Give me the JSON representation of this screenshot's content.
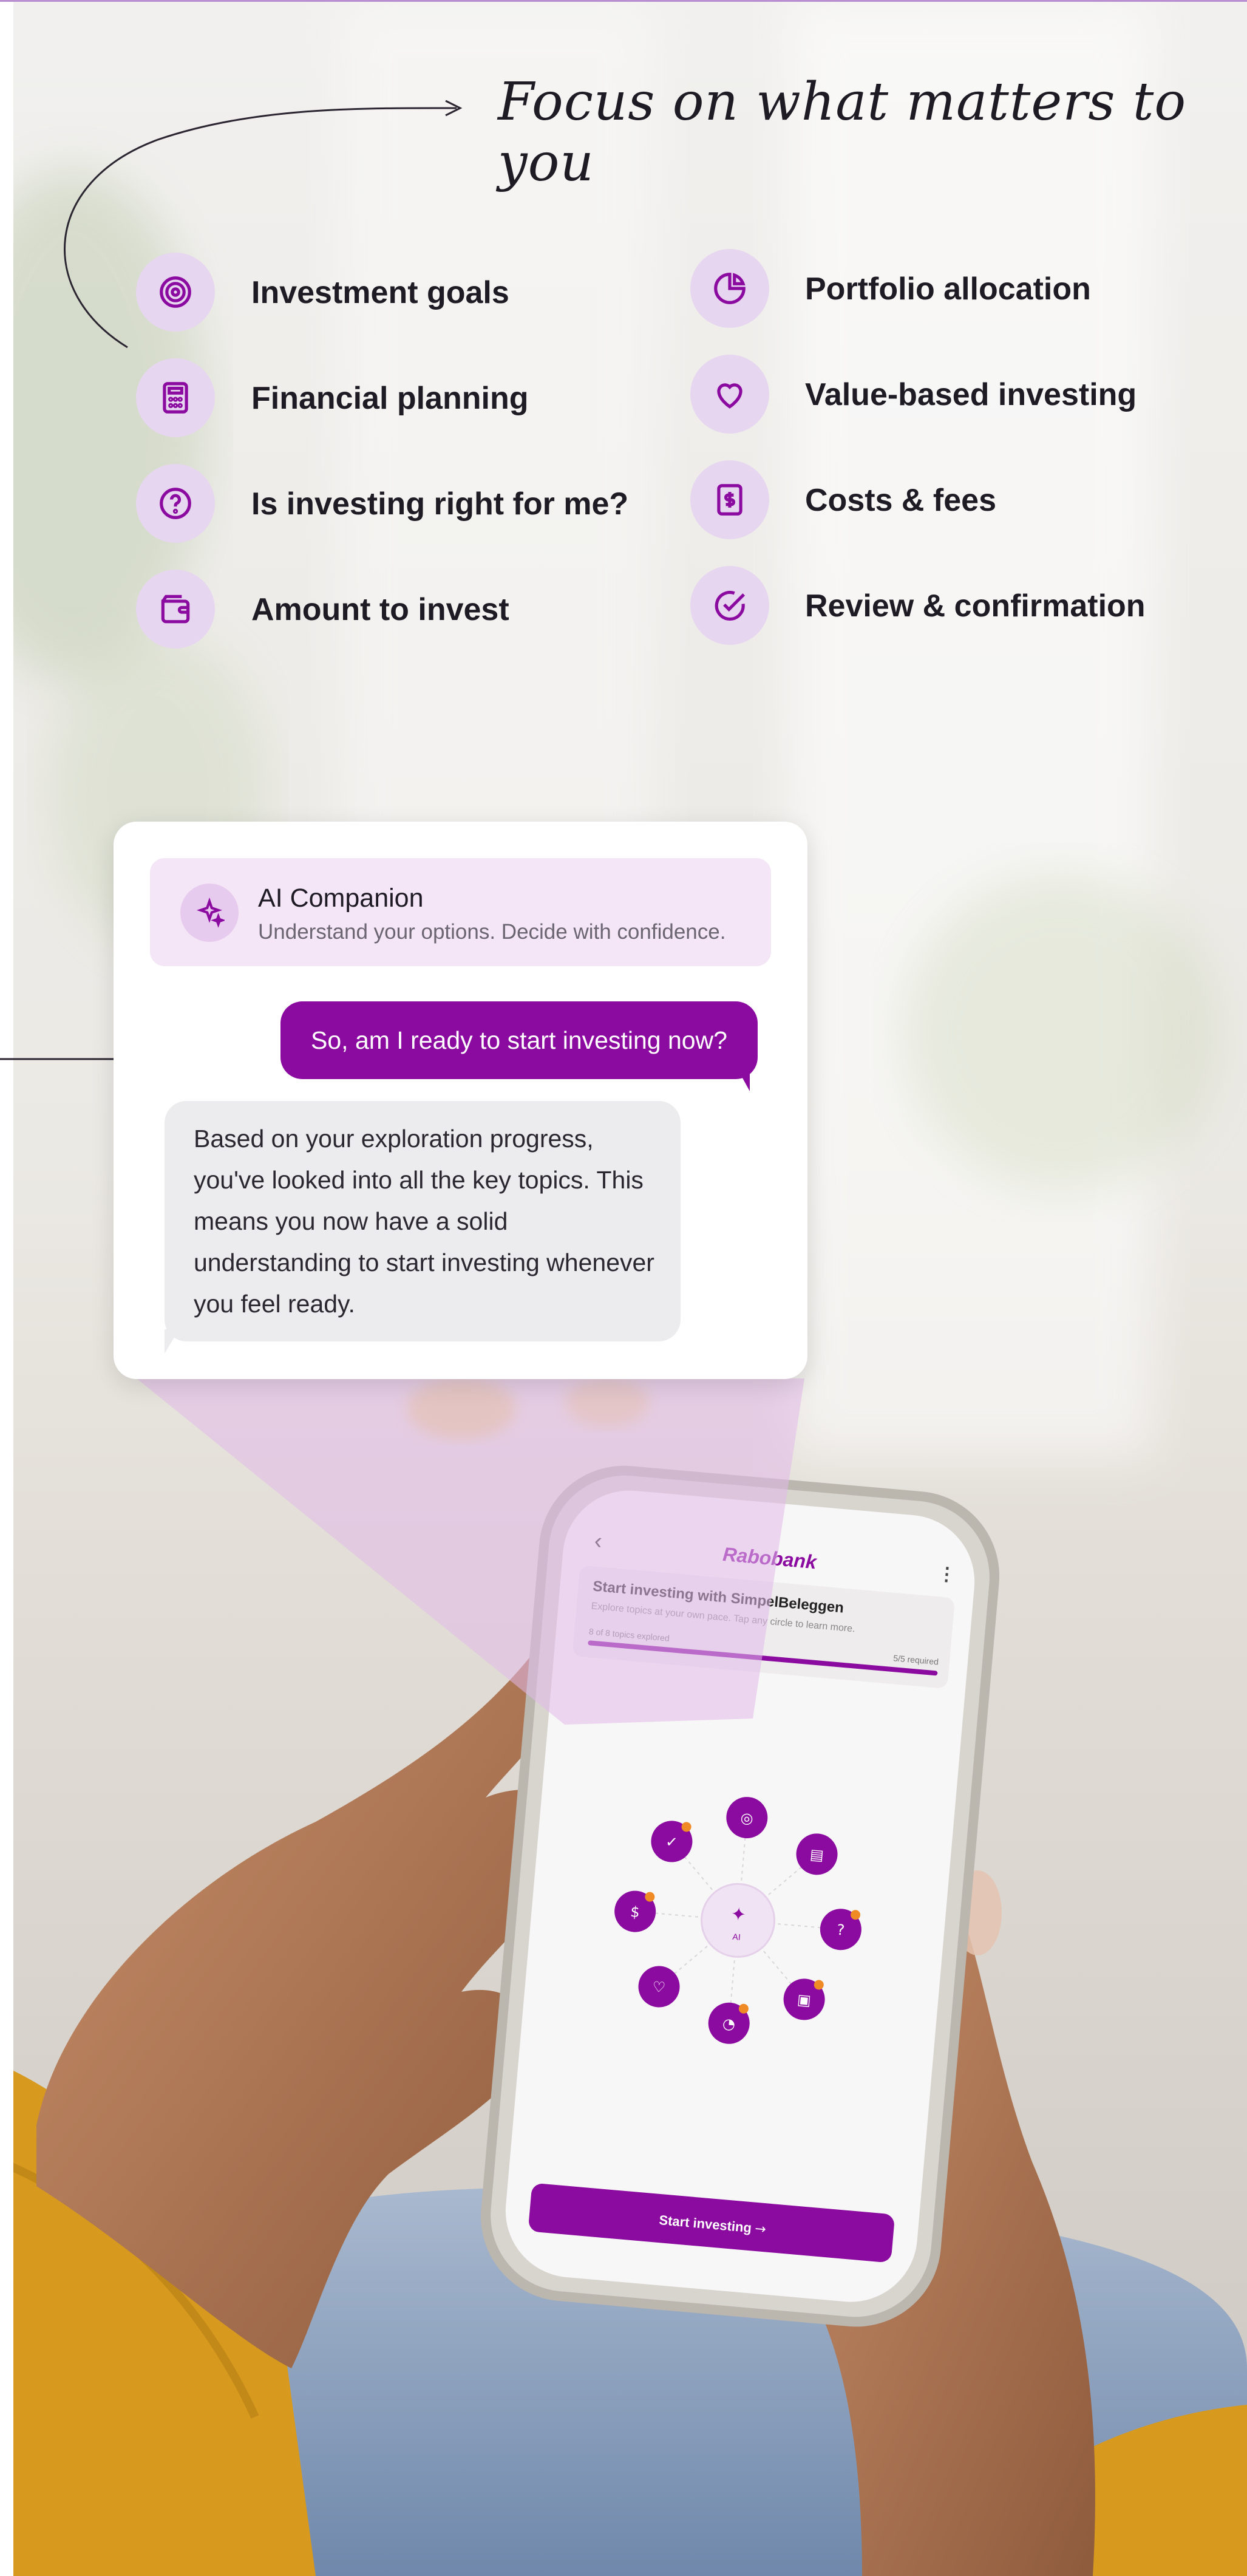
{
  "headline": "Focus on what matters to you",
  "topics_left": [
    {
      "label": "Investment goals",
      "icon": "target-icon"
    },
    {
      "label": "Financial planning",
      "icon": "calculator-icon"
    },
    {
      "label": "Is investing right for me?",
      "icon": "question-icon"
    },
    {
      "label": "Amount to invest",
      "icon": "wallet-icon"
    }
  ],
  "topics_right": [
    {
      "label": "Portfolio allocation",
      "icon": "pie-chart-icon"
    },
    {
      "label": "Value-based investing",
      "icon": "heart-icon"
    },
    {
      "label": "Costs & fees",
      "icon": "dollar-icon"
    },
    {
      "label": "Review & confirmation",
      "icon": "check-circle-icon"
    }
  ],
  "companion": {
    "title": "AI Companion",
    "subtitle": "Understand your options. Decide with confidence.",
    "user_message": "So, am I ready to start investing now?",
    "bot_message": "Based on your exploration progress, you've looked into all the key topics. This means you now have a solid understanding to start investing whenever you feel ready."
  },
  "phone": {
    "brand": "Rabobank",
    "title": "Start investing with SimpelBeleggen",
    "subtitle": "Explore topics at your own pace. Tap any circle to learn more.",
    "progress_label": "8 of 8 topics explored",
    "required_label": "5/5 required",
    "progress": 1.0,
    "center_label": "AI",
    "cta": "Start investing",
    "back_icon": "chevron-left-icon",
    "menu_icon": "more-vertical-icon"
  },
  "colors": {
    "accent": "#8b0aa0",
    "accent_light": "#e6d6ef",
    "text": "#1f1b24",
    "notification": "#f08a24"
  }
}
